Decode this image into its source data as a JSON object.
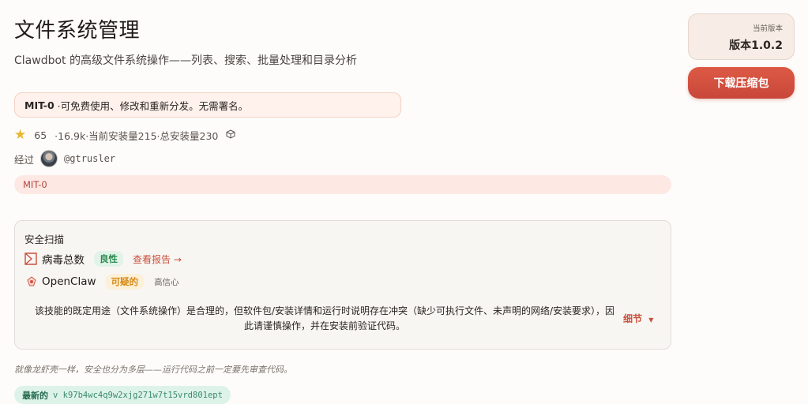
{
  "header": {
    "title": "文件系统管理",
    "subtitle": "Clawdbot 的高级文件系统操作——列表、搜索、批量处理和目录分析"
  },
  "license_notice": {
    "name": "MIT-0",
    "text": "·可免费使用、修改和重新分发。无需署名。"
  },
  "stats": {
    "star_icon": "star-icon",
    "stars": "65",
    "details": "·16.9k·当前安装量215·总安装量230",
    "cube_icon": "cube-icon"
  },
  "author": {
    "prefix": "经过",
    "handle": "@gtrusler"
  },
  "tag": "MIT-0",
  "security_scan": {
    "title": "安全扫描",
    "virustotal": {
      "name": "病毒总数",
      "status": "良性",
      "link": "查看报告 →",
      "status_color": "#2b8a4f"
    },
    "openclaw": {
      "name": "OpenClaw",
      "status": "可疑的",
      "confidence": "高信心",
      "status_color": "#d58a17"
    },
    "description": "该技能的既定用途（文件系统操作）是合理的，但软件包/安装详情和运行时说明存在冲突（缺少可执行文件、未声明的网络/安装要求），因此请谨慎操作，并在安装前验证代码。",
    "details_label": "细节",
    "details_icon": "caret-down-icon"
  },
  "footnote": "就像龙虾壳一样，安全也分为多层——运行代码之前一定要先审查代码。",
  "latest": {
    "label": "最新的",
    "hash": "v k97b4wc4q9w2xjg271w7t15vrd801ept"
  },
  "version": {
    "label": "当前版本",
    "value": "版本1.0.2"
  },
  "download_button": "下载压缩包",
  "colors": {
    "accent": "#d4503f",
    "background": "#fdfcfa"
  }
}
